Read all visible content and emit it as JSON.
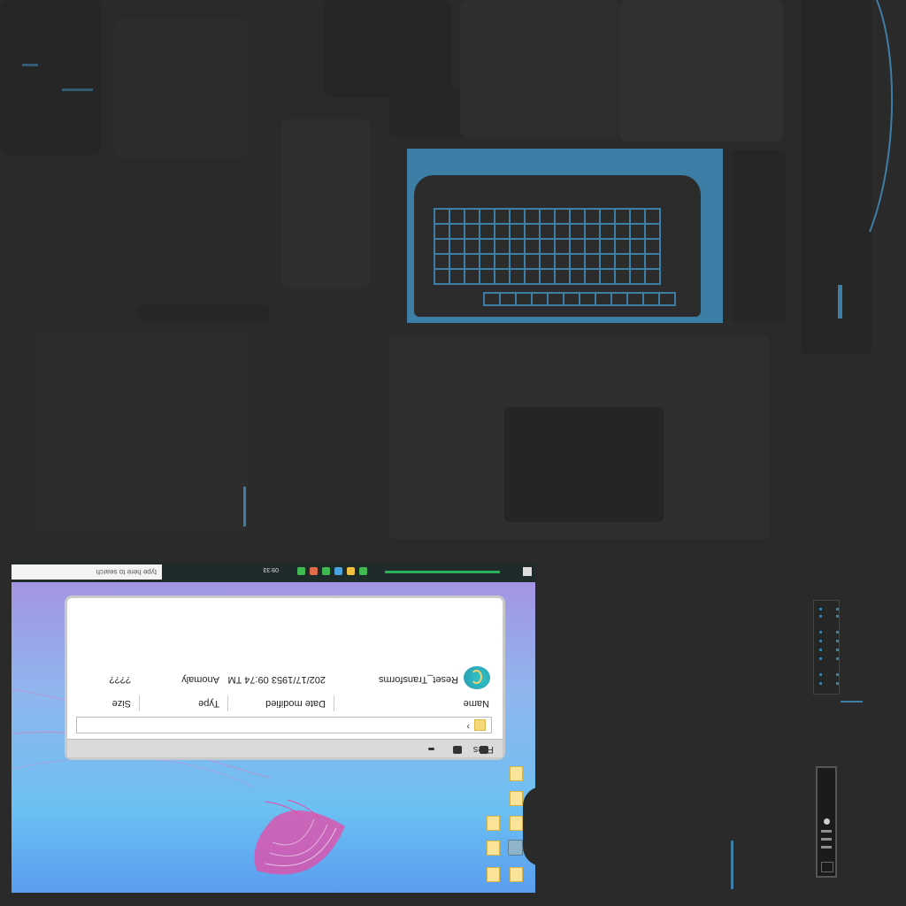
{
  "window": {
    "title": "Files",
    "address_separator": "›"
  },
  "columns": {
    "name": "Name",
    "date": "Date modified",
    "type": "Type",
    "size": "Size"
  },
  "files": [
    {
      "name": "Reset_Transforms",
      "date": "202/17/1953  09:74 TM",
      "type": "Anomaly",
      "size": "????"
    }
  ],
  "taskbar": {
    "search_placeholder": "type here to search",
    "clock": "09:33"
  },
  "colors": {
    "accent": "#3d7ea6",
    "desktop_top": "#a78fe0",
    "desktop_bottom": "#5a9df0",
    "folder": "#fbe39a"
  },
  "icons": [
    "folder-icon",
    "computer-icon",
    "reset-transforms-icon",
    "keyboard-icon",
    "tower-pc-icon"
  ]
}
